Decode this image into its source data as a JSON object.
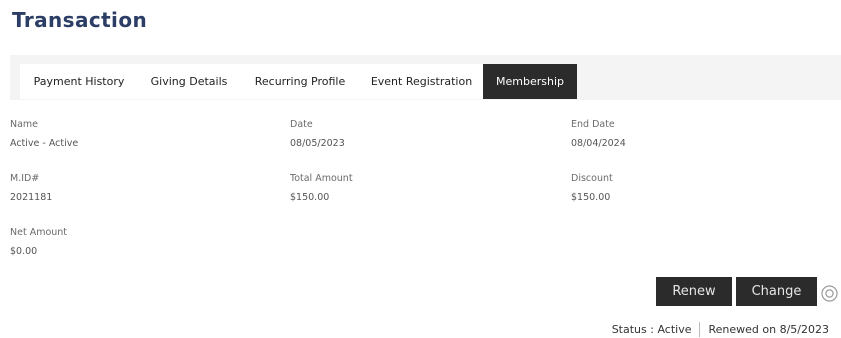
{
  "header": {
    "title": "Transaction"
  },
  "tabs": [
    {
      "label": "Payment History",
      "active": false
    },
    {
      "label": "Giving Details",
      "active": false
    },
    {
      "label": "Recurring Profile",
      "active": false
    },
    {
      "label": "Event Registration",
      "active": false
    },
    {
      "label": "Membership",
      "active": true
    }
  ],
  "details": {
    "name": {
      "label": "Name",
      "value": "Active - Active"
    },
    "date": {
      "label": "Date",
      "value": "08/05/2023"
    },
    "end_date": {
      "label": "End Date",
      "value": "08/04/2024"
    },
    "mid": {
      "label": "M.ID#",
      "value": "2021181"
    },
    "total_amount": {
      "label": "Total Amount",
      "value": "$150.00"
    },
    "discount": {
      "label": "Discount",
      "value": "$150.00"
    },
    "net_amount": {
      "label": "Net Amount",
      "value": "$0.00"
    }
  },
  "actions": {
    "renew_label": "Renew",
    "change_label": "Change",
    "help_icon": "circle-info-icon"
  },
  "status": {
    "status_text": "Status : Active",
    "renewed_text": "Renewed on 8/5/2023"
  },
  "colors": {
    "title": "#2c3e66",
    "active_tab": "#2b2b2b",
    "button": "#2b2b2b",
    "tab_strip": "#f4f4f4"
  }
}
